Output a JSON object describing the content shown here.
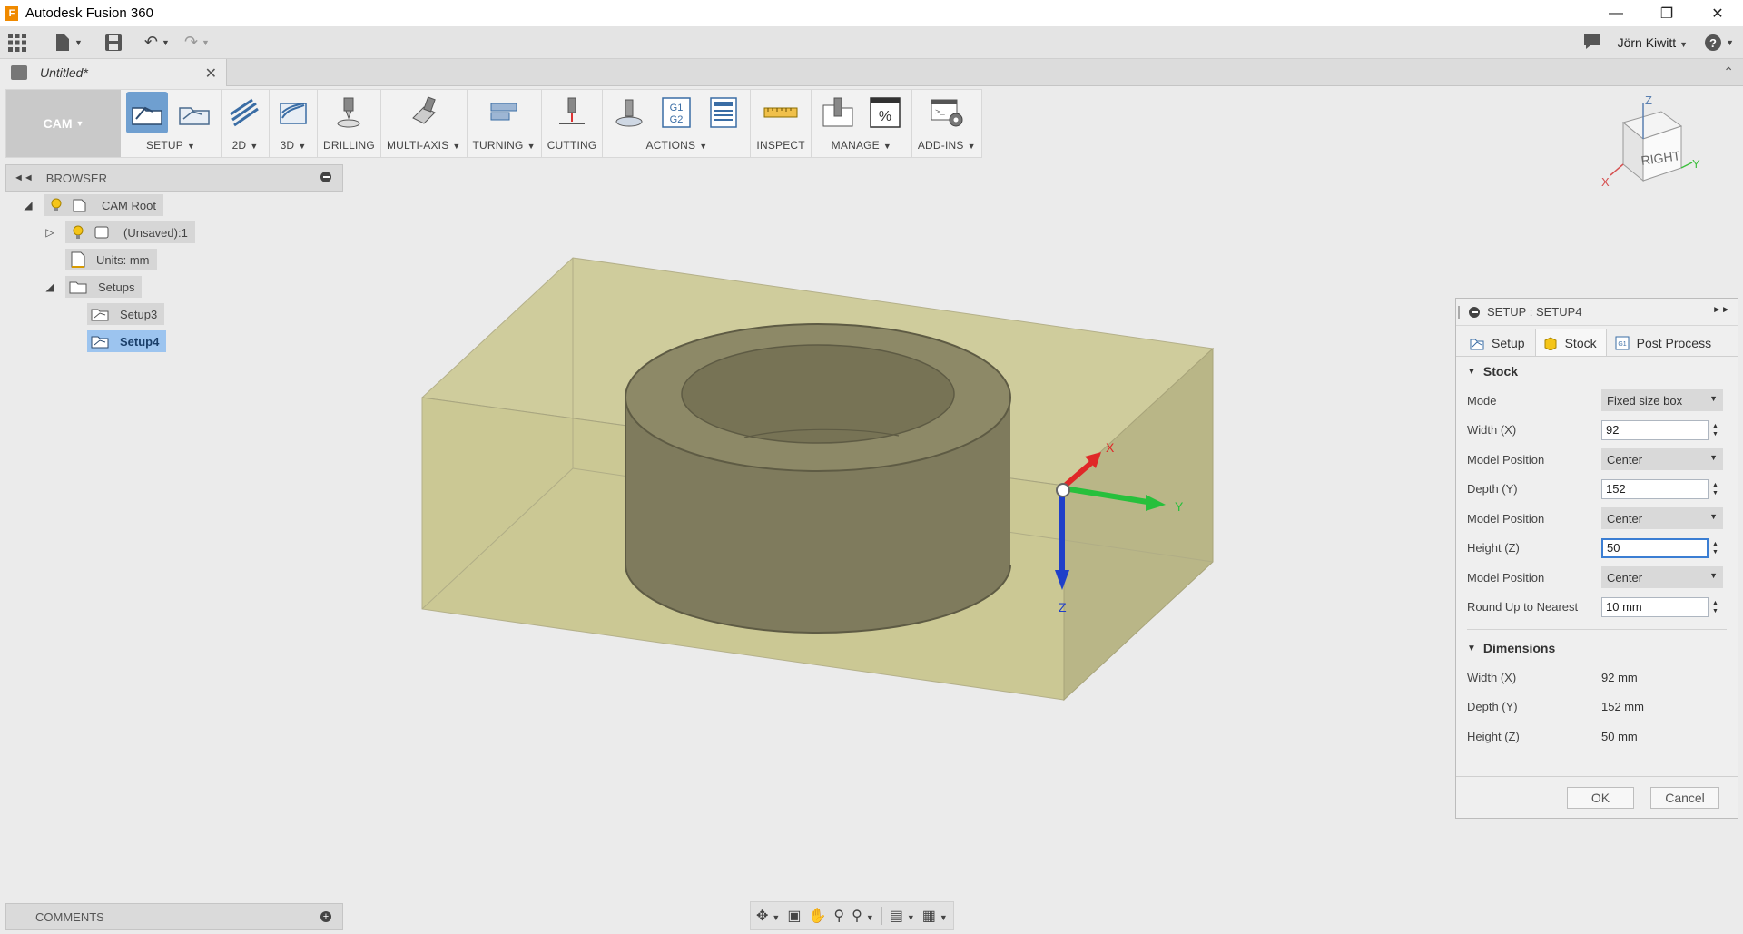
{
  "app": {
    "title": "Autodesk Fusion 360",
    "logo_letter": "F"
  },
  "quick_access": {
    "user": "Jörn Kiwitt"
  },
  "document": {
    "tab_title": "Untitled*"
  },
  "toolbar": {
    "workspace": "CAM",
    "groups": [
      "SETUP",
      "2D",
      "3D",
      "DRILLING",
      "MULTI-AXIS",
      "TURNING",
      "CUTTING",
      "ACTIONS",
      "INSPECT",
      "MANAGE",
      "ADD-INS"
    ]
  },
  "browser": {
    "title": "BROWSER",
    "nodes": [
      "CAM Root",
      "(Unsaved):1",
      "Units: mm",
      "Setups",
      "Setup3",
      "Setup4"
    ]
  },
  "comments": {
    "title": "COMMENTS"
  },
  "viewcube": {
    "face": "RIGHT",
    "axes": [
      "Z",
      "X",
      "Y"
    ]
  },
  "triad": {
    "x": "X",
    "y": "Y",
    "z": "Z"
  },
  "dialog": {
    "title": "SETUP : SETUP4",
    "tabs": [
      "Setup",
      "Stock",
      "Post Process"
    ],
    "stock_section": "Stock",
    "rows": {
      "mode": {
        "label": "Mode",
        "value": "Fixed size box"
      },
      "width": {
        "label": "Width (X)",
        "value": "92"
      },
      "model_pos_1": {
        "label": "Model Position",
        "value": "Center"
      },
      "depth": {
        "label": "Depth (Y)",
        "value": "152"
      },
      "model_pos_2": {
        "label": "Model Position",
        "value": "Center"
      },
      "height": {
        "label": "Height (Z)",
        "value": "50"
      },
      "model_pos_3": {
        "label": "Model Position",
        "value": "Center"
      },
      "round_up": {
        "label": "Round Up to Nearest",
        "value": "10 mm"
      }
    },
    "dimensions_section": "Dimensions",
    "dimensions": {
      "width": {
        "label": "Width (X)",
        "value": "92 mm"
      },
      "depth": {
        "label": "Depth (Y)",
        "value": "152 mm"
      },
      "height": {
        "label": "Height (Z)",
        "value": "50 mm"
      }
    },
    "ok": "OK",
    "cancel": "Cancel"
  },
  "colors": {
    "accent": "#3b7ed3",
    "stock": "#c9c79a",
    "part": "#7c785a",
    "selection": "#9cc4ef"
  }
}
